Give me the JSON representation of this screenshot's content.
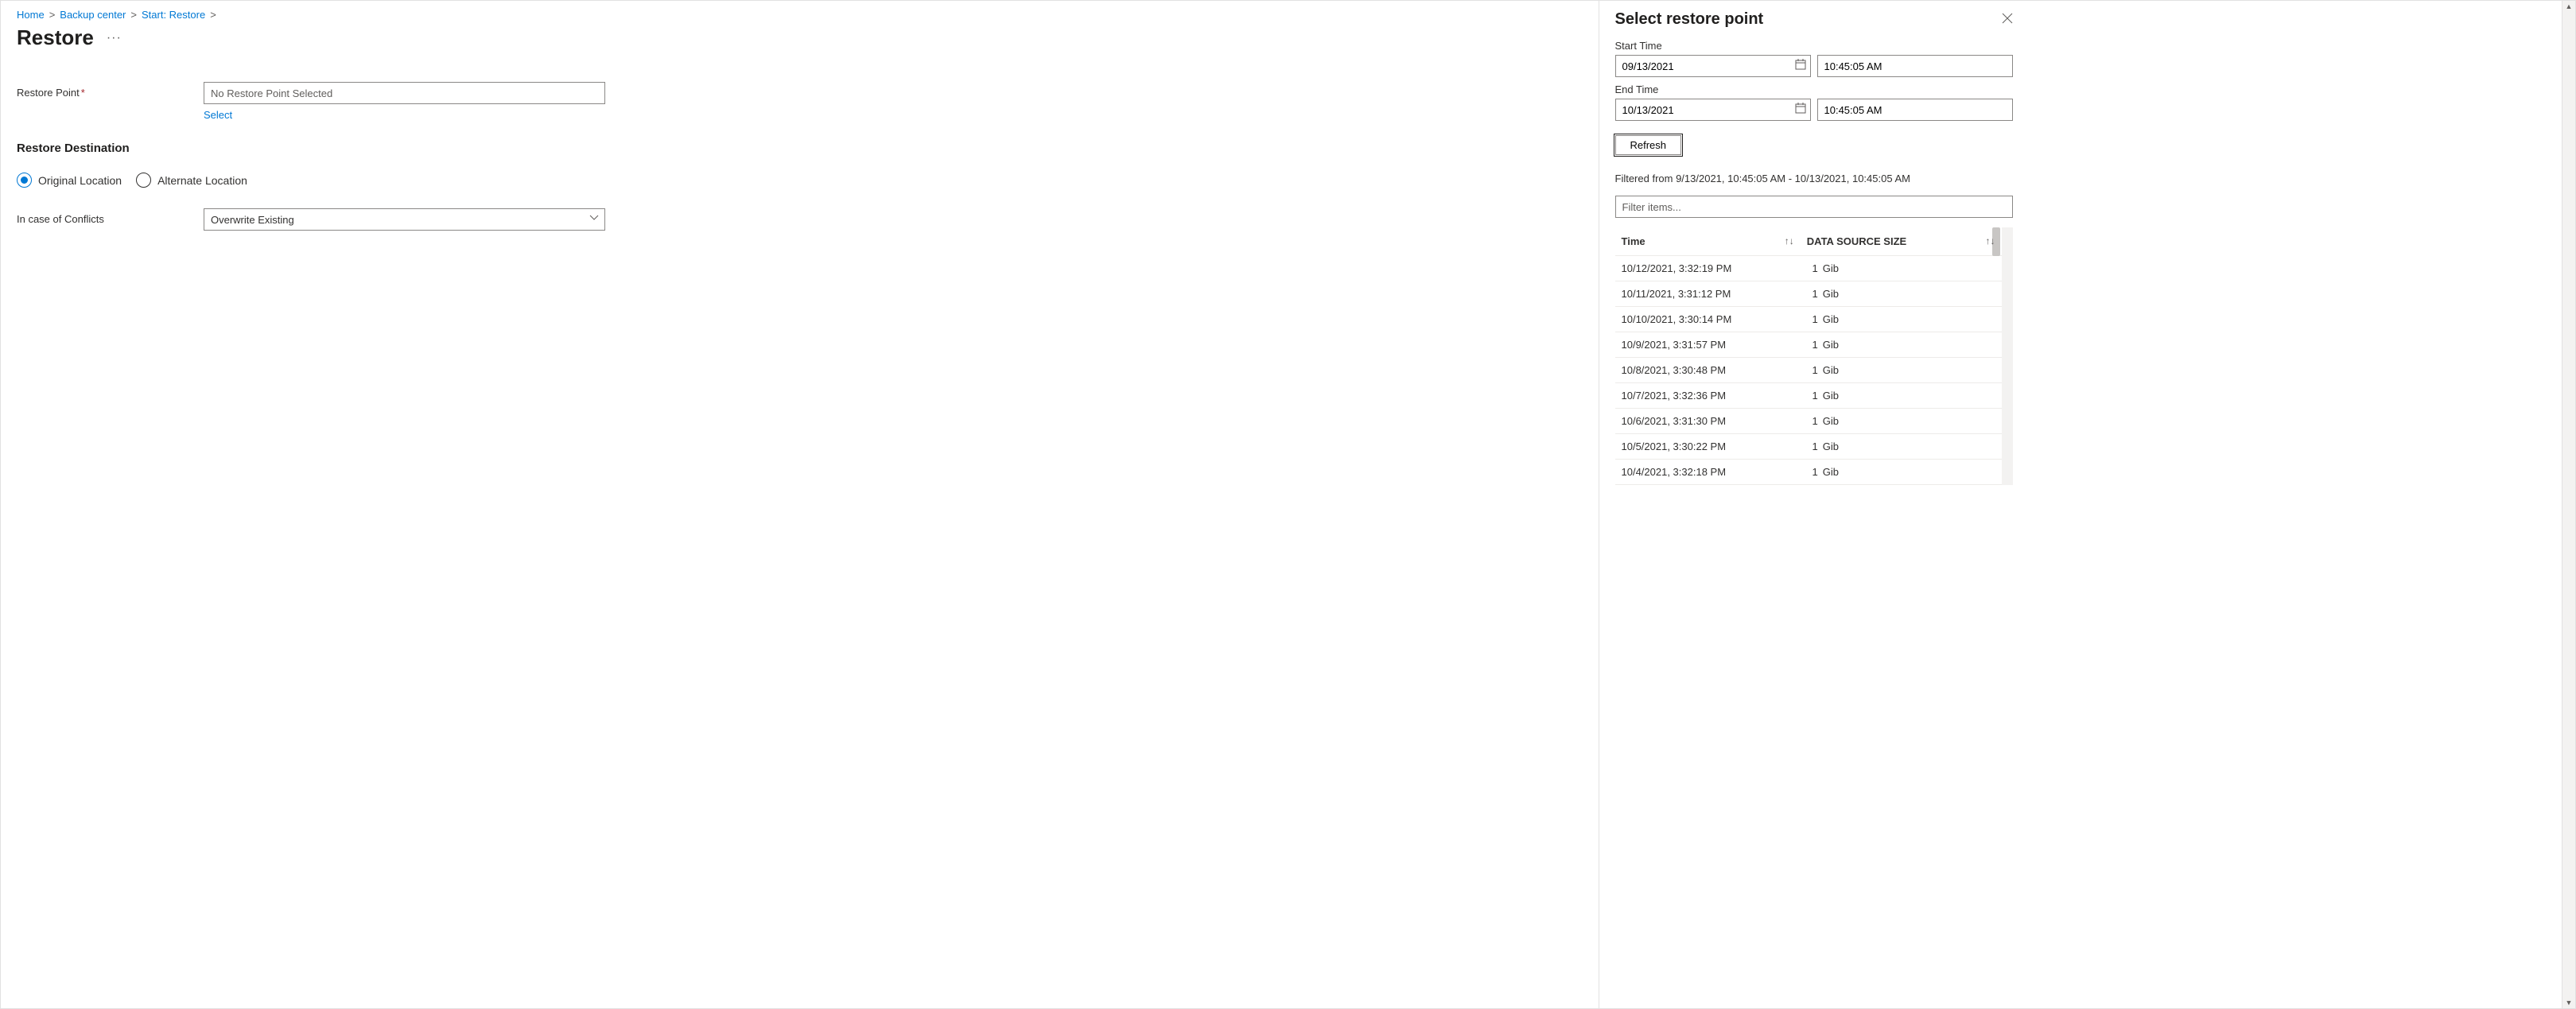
{
  "breadcrumb": {
    "home": "Home",
    "backup_center": "Backup center",
    "start_restore": "Start: Restore"
  },
  "page": {
    "title": "Restore",
    "more": "···"
  },
  "form": {
    "restore_point_label": "Restore Point",
    "restore_point_value": "No Restore Point Selected",
    "select_link": "Select",
    "destination_heading": "Restore Destination",
    "radio_original": "Original Location",
    "radio_alternate": "Alternate Location",
    "conflicts_label": "In case of Conflicts",
    "conflicts_value": "Overwrite Existing"
  },
  "panel": {
    "title": "Select restore point",
    "start_time_label": "Start Time",
    "start_date": "09/13/2021",
    "start_time": "10:45:05 AM",
    "end_time_label": "End Time",
    "end_date": "10/13/2021",
    "end_time": "10:45:05 AM",
    "refresh": "Refresh",
    "filter_summary": "Filtered from 9/13/2021, 10:45:05 AM - 10/13/2021, 10:45:05 AM",
    "filter_placeholder": "Filter items...",
    "col_time": "Time",
    "col_size": "DATA SOURCE SIZE",
    "rows": [
      {
        "time": "10/12/2021, 3:32:19 PM",
        "num": "1",
        "unit": "Gib"
      },
      {
        "time": "10/11/2021, 3:31:12 PM",
        "num": "1",
        "unit": "Gib"
      },
      {
        "time": "10/10/2021, 3:30:14 PM",
        "num": "1",
        "unit": "Gib"
      },
      {
        "time": "10/9/2021, 3:31:57 PM",
        "num": "1",
        "unit": "Gib"
      },
      {
        "time": "10/8/2021, 3:30:48 PM",
        "num": "1",
        "unit": "Gib"
      },
      {
        "time": "10/7/2021, 3:32:36 PM",
        "num": "1",
        "unit": "Gib"
      },
      {
        "time": "10/6/2021, 3:31:30 PM",
        "num": "1",
        "unit": "Gib"
      },
      {
        "time": "10/5/2021, 3:30:22 PM",
        "num": "1",
        "unit": "Gib"
      },
      {
        "time": "10/4/2021, 3:32:18 PM",
        "num": "1",
        "unit": "Gib"
      }
    ]
  }
}
